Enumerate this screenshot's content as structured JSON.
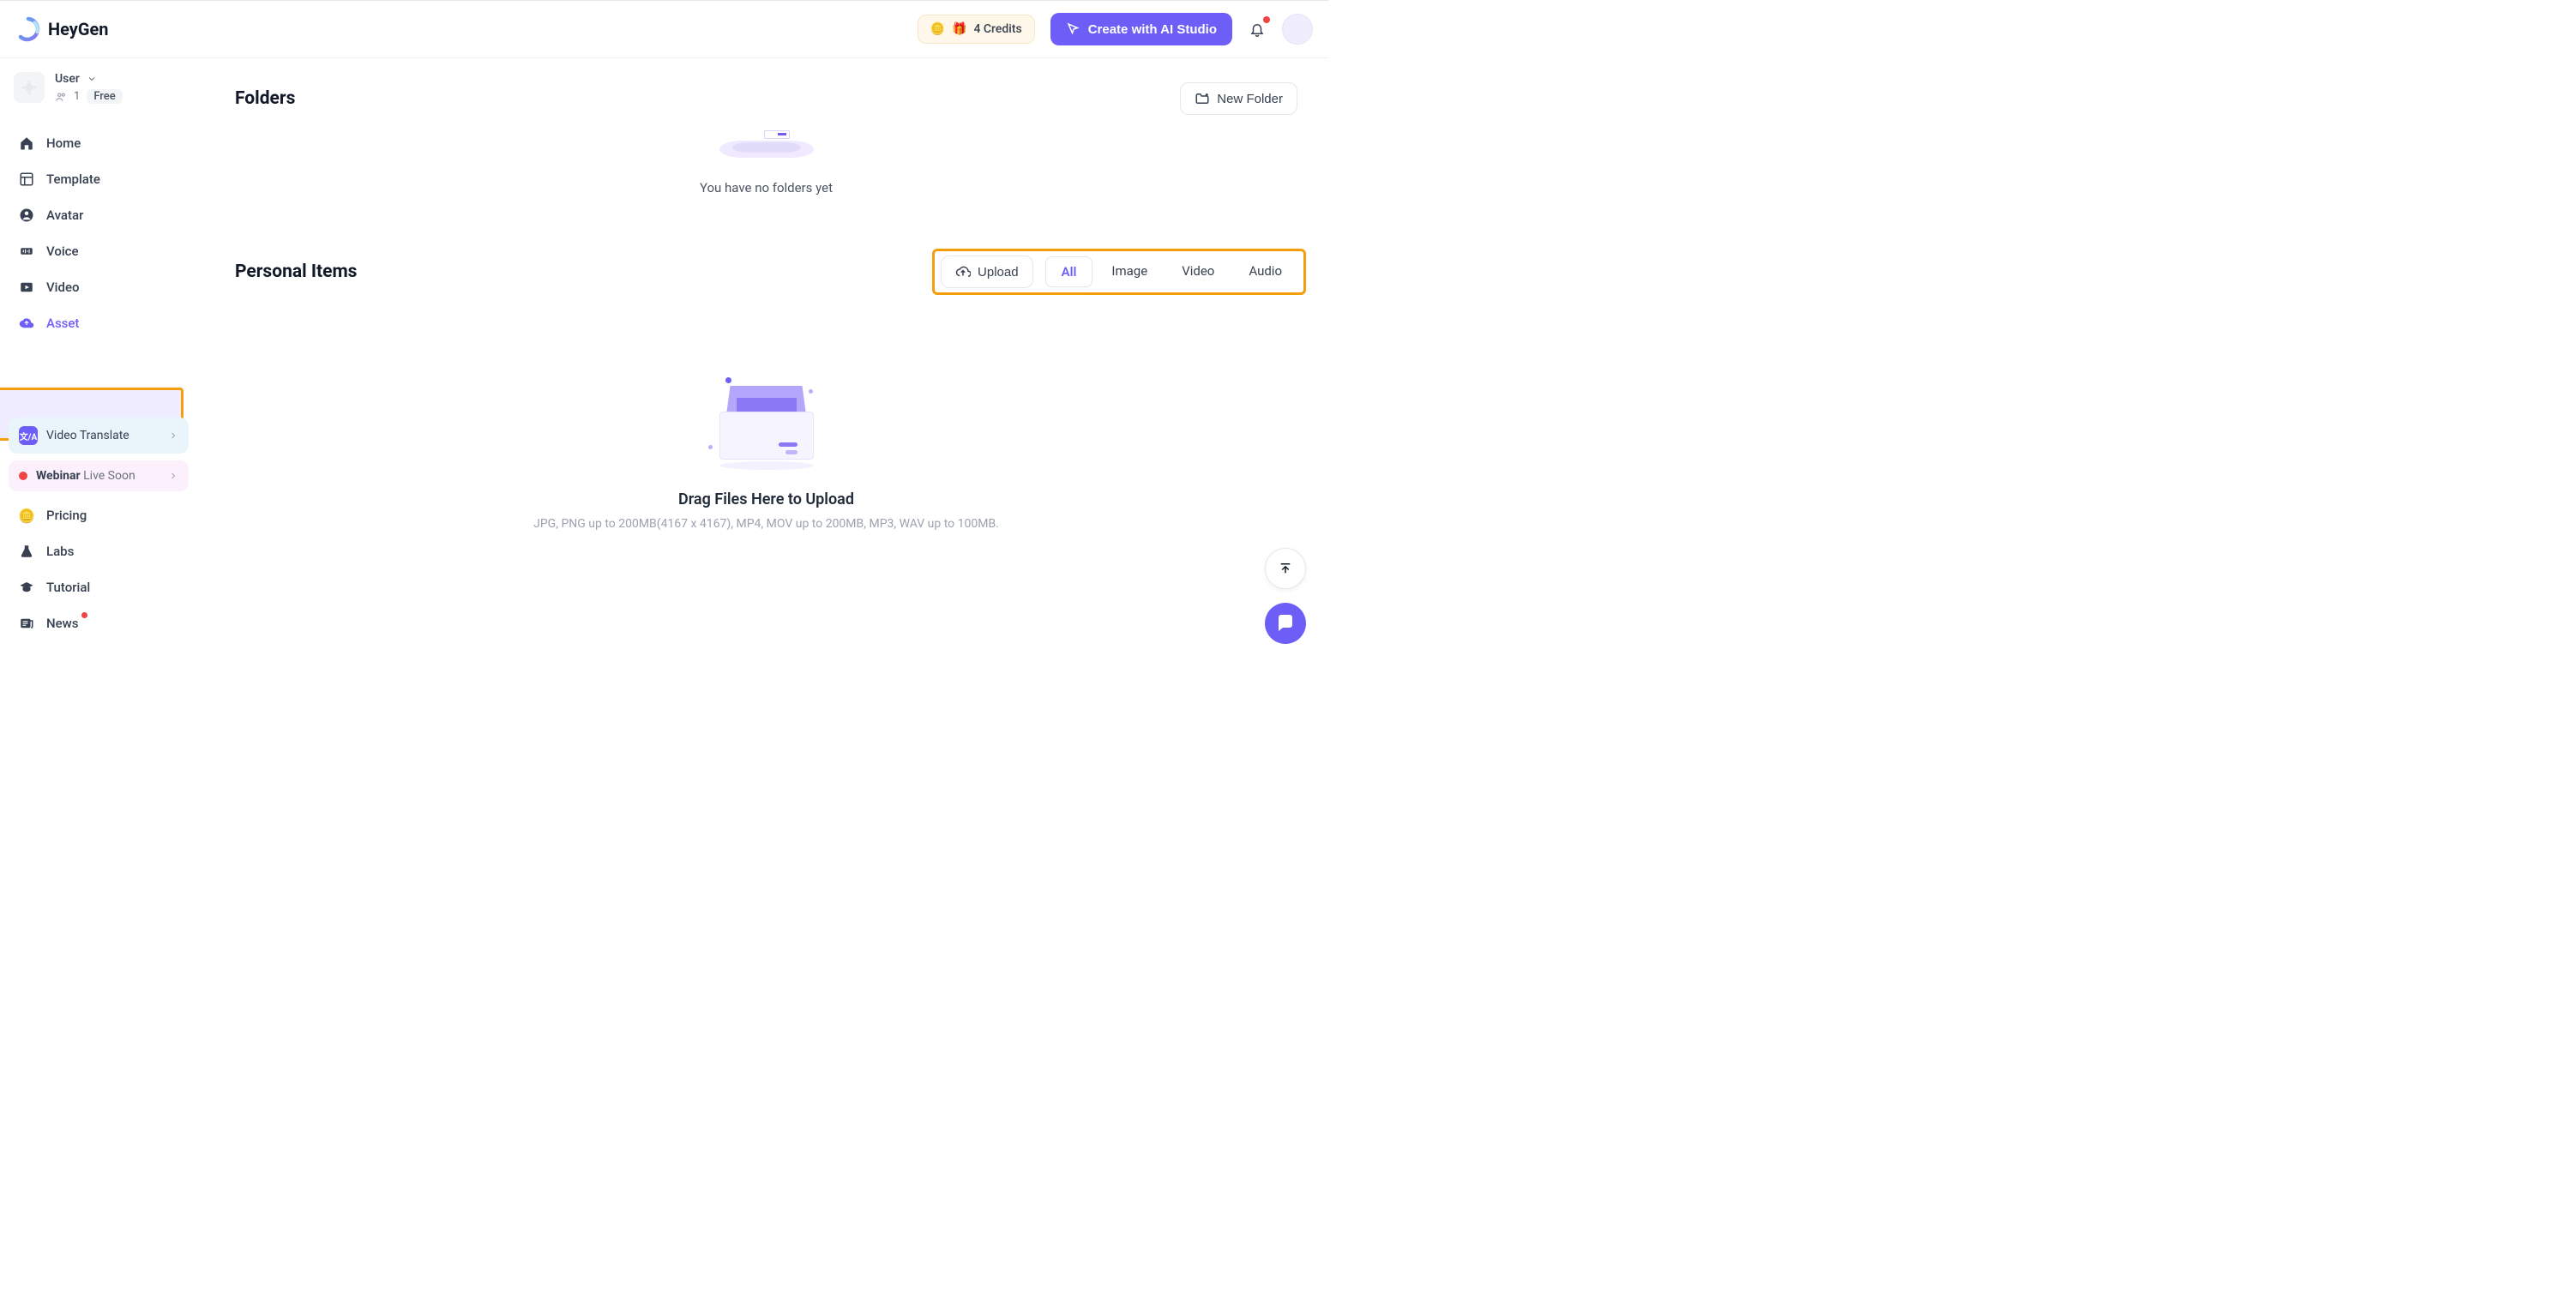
{
  "header": {
    "brand": "HeyGen",
    "credits_label": "4 Credits",
    "create_label": "Create with AI Studio"
  },
  "user": {
    "name": "User",
    "count": "1",
    "plan": "Free"
  },
  "nav": {
    "home": "Home",
    "template": "Template",
    "avatar": "Avatar",
    "voice": "Voice",
    "video": "Video",
    "asset": "Asset",
    "translate": "Video Translate",
    "webinar_strong": "Webinar",
    "webinar_rest": " Live Soon",
    "pricing": "Pricing",
    "labs": "Labs",
    "tutorial": "Tutorial",
    "news": "News"
  },
  "folders": {
    "title": "Folders",
    "new_folder": "New Folder",
    "empty": "You have no folders yet"
  },
  "personal": {
    "title": "Personal Items",
    "upload": "Upload",
    "tabs": {
      "all": "All",
      "image": "Image",
      "video": "Video",
      "audio": "Audio"
    }
  },
  "dropzone": {
    "title": "Drag Files Here to Upload",
    "sub": "JPG, PNG up to 200MB(4167 x 4167), MP4, MOV up to 200MB, MP3, WAV up to 100MB."
  }
}
